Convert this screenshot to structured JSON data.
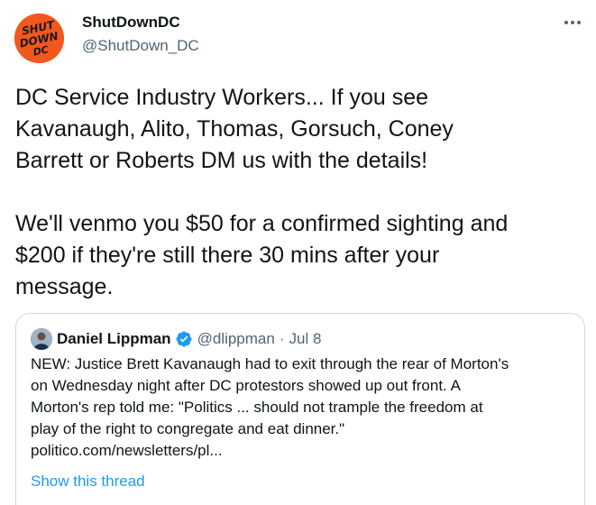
{
  "author": {
    "display_name": "ShutDownDC",
    "handle": "@ShutDown_DC",
    "avatar_text": [
      "SHUT",
      "DOWN",
      "DC"
    ]
  },
  "more_icon": "more-horizontal-icon",
  "tweet": {
    "text": "DC Service Industry Workers... If you see\nKavanaugh, Alito, Thomas, Gorsuch, Coney\nBarrett or Roberts DM us with the details!\n\nWe'll venmo you $50 for a confirmed sighting and\n$200 if they're still there 30 mins after your\nmessage."
  },
  "quoted_tweet": {
    "author_name": "Daniel Lippman",
    "verified": true,
    "handle": "@dlippman",
    "separator": "·",
    "date": "Jul 8",
    "text": "NEW: Justice Brett Kavanaugh had to exit through the rear of Morton's\non Wednesday night after DC protestors showed up out front. A\nMorton's rep told me: \"Politics ... should not trample the freedom at\nplay of the right to congregate and eat dinner.\"\npolitico.com/newsletters/pl...",
    "show_thread_label": "Show this thread"
  },
  "colors": {
    "brand_orange": "#f2581e",
    "link_blue": "#1d9bf0",
    "secondary_text": "#536471",
    "border": "#cfd9de"
  }
}
